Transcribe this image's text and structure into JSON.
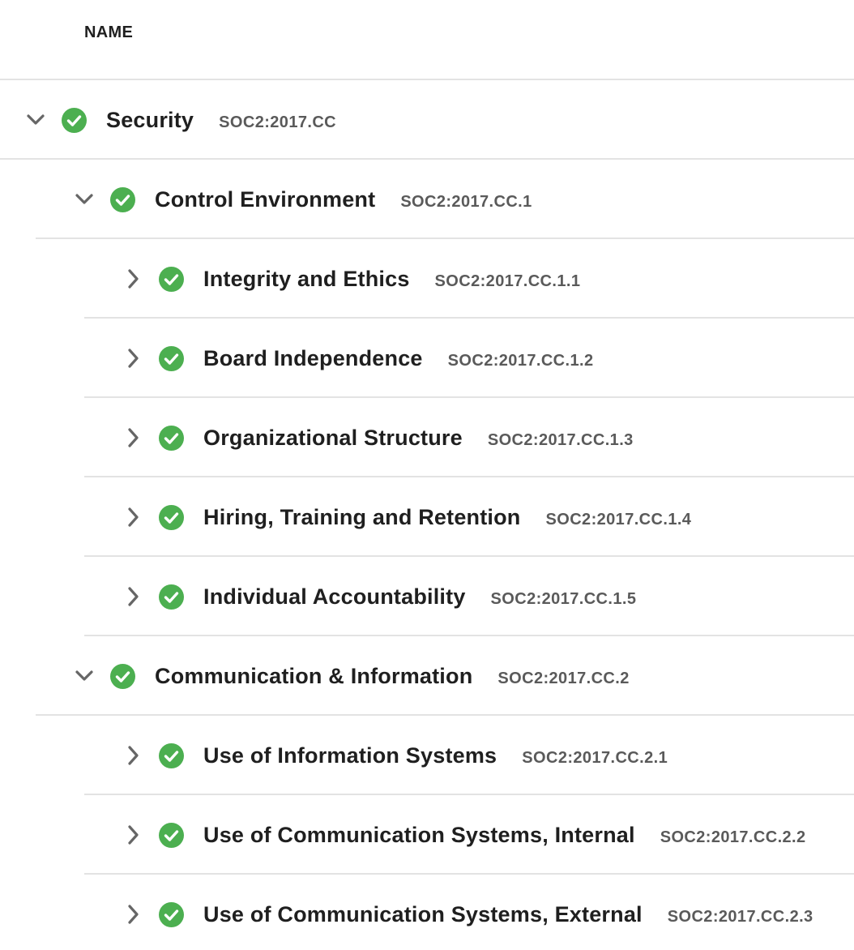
{
  "header": {
    "name_label": "NAME"
  },
  "colors": {
    "status_green": "#4caf50",
    "divider": "#e3e3e3"
  },
  "icons": {
    "expanded": "chevron-down-icon",
    "collapsed": "chevron-right-icon",
    "status": "check-circle-icon"
  },
  "tree": [
    {
      "title": "Security",
      "code": "SOC2:2017.CC",
      "level": 0,
      "expanded": true,
      "status": "complete"
    },
    {
      "title": "Control Environment",
      "code": "SOC2:2017.CC.1",
      "level": 1,
      "expanded": true,
      "status": "complete"
    },
    {
      "title": "Integrity and Ethics",
      "code": "SOC2:2017.CC.1.1",
      "level": 2,
      "expanded": false,
      "status": "complete"
    },
    {
      "title": "Board Independence",
      "code": "SOC2:2017.CC.1.2",
      "level": 2,
      "expanded": false,
      "status": "complete"
    },
    {
      "title": "Organizational Structure",
      "code": "SOC2:2017.CC.1.3",
      "level": 2,
      "expanded": false,
      "status": "complete"
    },
    {
      "title": "Hiring, Training and Retention",
      "code": "SOC2:2017.CC.1.4",
      "level": 2,
      "expanded": false,
      "status": "complete"
    },
    {
      "title": "Individual Accountability",
      "code": "SOC2:2017.CC.1.5",
      "level": 2,
      "expanded": false,
      "status": "complete"
    },
    {
      "title": "Communication & Information",
      "code": "SOC2:2017.CC.2",
      "level": 1,
      "expanded": true,
      "status": "complete"
    },
    {
      "title": "Use of Information Systems",
      "code": "SOC2:2017.CC.2.1",
      "level": 2,
      "expanded": false,
      "status": "complete"
    },
    {
      "title": "Use of Communication Systems, Internal",
      "code": "SOC2:2017.CC.2.2",
      "level": 2,
      "expanded": false,
      "status": "complete"
    },
    {
      "title": "Use of Communication Systems, External",
      "code": "SOC2:2017.CC.2.3",
      "level": 2,
      "expanded": false,
      "status": "complete"
    }
  ]
}
